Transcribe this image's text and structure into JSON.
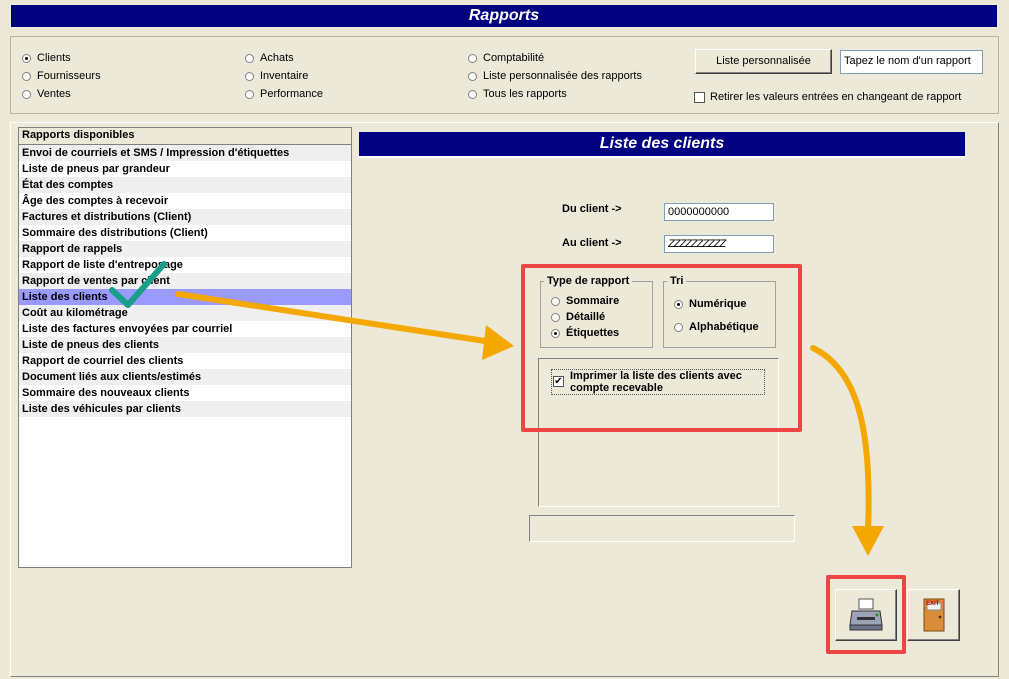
{
  "window": {
    "title": "Rapports"
  },
  "categories": [
    {
      "label": "Clients",
      "selected": true
    },
    {
      "label": "Fournisseurs",
      "selected": false
    },
    {
      "label": "Ventes",
      "selected": false
    },
    {
      "label": "Achats",
      "selected": false
    },
    {
      "label": "Inventaire",
      "selected": false
    },
    {
      "label": "Performance",
      "selected": false
    },
    {
      "label": "Comptabilité",
      "selected": false
    },
    {
      "label": "Liste personnalisée des rapports",
      "selected": false
    },
    {
      "label": "Tous les rapports",
      "selected": false
    }
  ],
  "custom_list": {
    "button_label": "Liste personnalisée",
    "search_placeholder": "Tapez le nom d'un rapport",
    "reset_checkbox_label": "Retirer les valeurs entrées en changeant de rapport"
  },
  "reports": {
    "header": "Rapports disponibles",
    "items": [
      "Envoi de courriels et SMS / Impression d'étiquettes",
      "Liste de pneus par grandeur",
      "État des comptes",
      "Âge des comptes à recevoir",
      "Factures et distributions (Client)",
      "Sommaire des distributions (Client)",
      "Rapport de rappels",
      "Rapport de liste d'entreposage",
      "Rapport de ventes par client",
      "Liste des clients",
      "Coût au kilométrage",
      "Liste des factures envoyées par courriel",
      "Liste de pneus des clients",
      "Rapport de courriel des clients",
      "Document liés aux clients/estimés",
      "Sommaire des nouveaux clients",
      "Liste des véhicules par clients"
    ],
    "selected": "Liste des clients"
  },
  "detail": {
    "title": "Liste des clients",
    "from_label": "Du client ->",
    "from_value": "0000000000",
    "to_label": "Au client ->",
    "to_value": "ZZZZZZZZZZ",
    "type_group": {
      "legend": "Type de rapport",
      "options": [
        "Sommaire",
        "Détaillé",
        "Étiquettes"
      ],
      "selected": "Étiquettes"
    },
    "sort_group": {
      "legend": "Tri",
      "options": [
        "Numérique",
        "Alphabétique"
      ],
      "selected": "Numérique"
    },
    "print_receivable": {
      "label_line1": "Imprimer la liste des clients avec",
      "label_line2": "compte recevable",
      "checked": true
    },
    "exit_sign": "EXIT"
  },
  "colors": {
    "title_bar": "#000080",
    "selection": "#9999ff",
    "highlight_box": "#ee4444",
    "arrow": "#f5a800",
    "checkmark": "#1a9e8c"
  }
}
